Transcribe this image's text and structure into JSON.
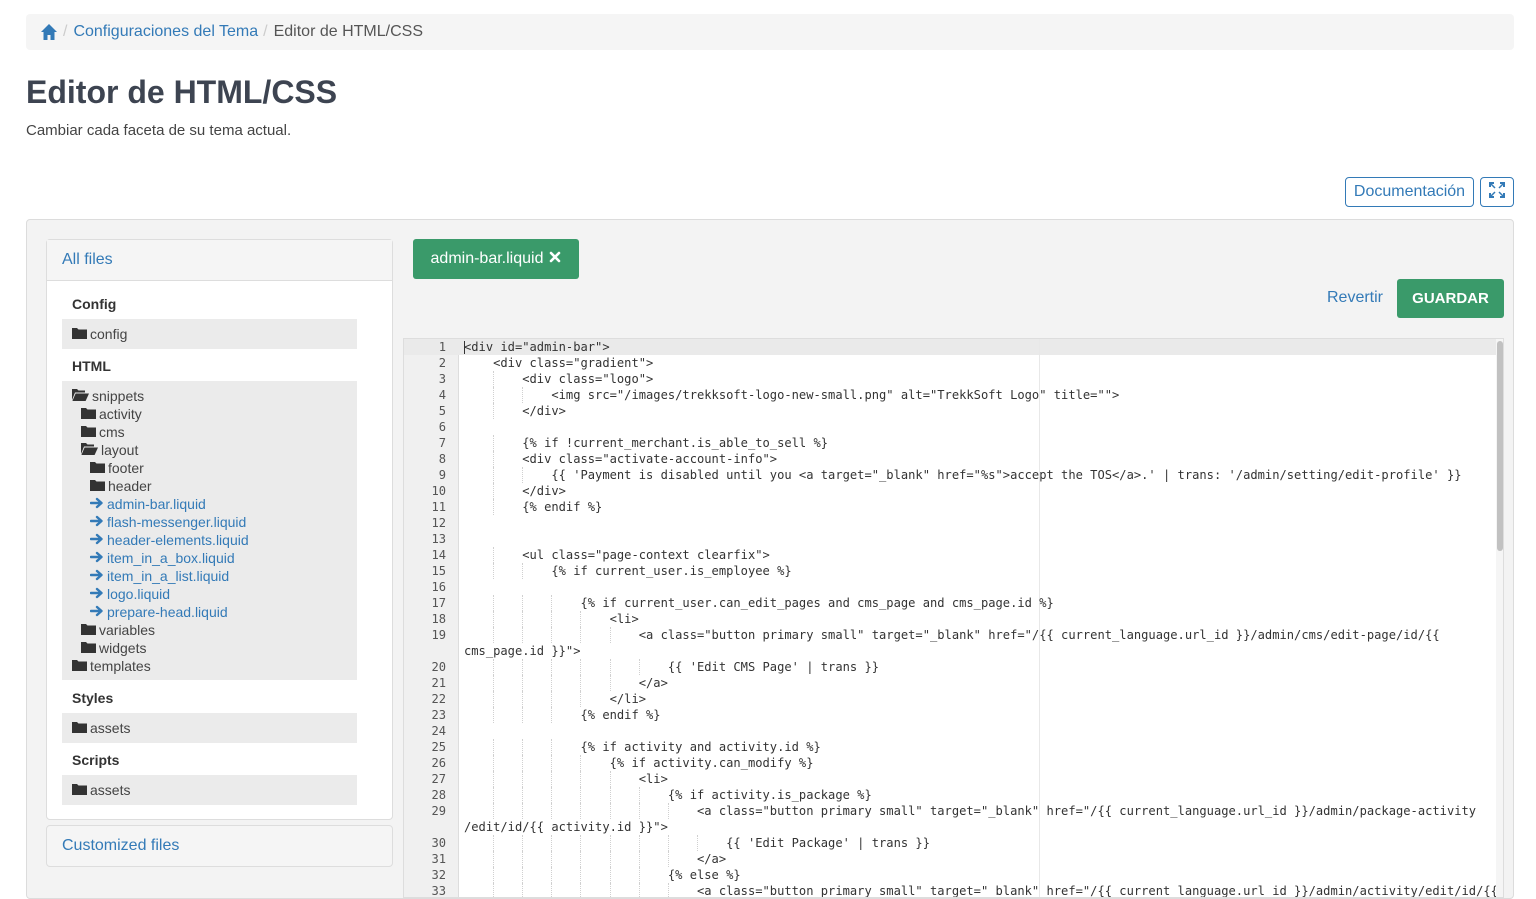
{
  "breadcrumb": {
    "home_icon": "home-icon",
    "items": [
      "Configuraciones del Tema",
      "Editor de HTML/CSS"
    ]
  },
  "page": {
    "title": "Editor de HTML/CSS",
    "subtitle": "Cambiar cada faceta de su tema actual."
  },
  "toolbar": {
    "documentation_label": "Documentación",
    "fullscreen_icon": "expand-icon"
  },
  "sidebar": {
    "all_files_label": "All files",
    "customized_files_label": "Customized files",
    "groups": {
      "config": {
        "title": "Config",
        "items": [
          "config"
        ]
      },
      "html": {
        "title": "HTML",
        "items": [
          "snippets",
          "activity",
          "cms",
          "layout",
          "footer",
          "header",
          "admin-bar.liquid",
          "flash-messenger.liquid",
          "header-elements.liquid",
          "item_in_a_box.liquid",
          "item_in_a_list.liquid",
          "logo.liquid",
          "prepare-head.liquid",
          "variables",
          "widgets",
          "templates"
        ]
      },
      "styles": {
        "title": "Styles",
        "items": [
          "assets"
        ]
      },
      "scripts": {
        "title": "Scripts",
        "items": [
          "assets"
        ]
      }
    }
  },
  "editor": {
    "open_tab": "admin-bar.liquid",
    "close_icon": "close-icon",
    "revert_label": "Revertir",
    "save_label": "GUARDAR",
    "lines": [
      {
        "n": "1",
        "t": "<div id=\"admin-bar\">"
      },
      {
        "n": "2",
        "t": "    <div class=\"gradient\">"
      },
      {
        "n": "3",
        "t": "        <div class=\"logo\">"
      },
      {
        "n": "4",
        "t": "            <img src=\"/images/trekksoft-logo-new-small.png\" alt=\"TrekkSoft Logo\" title=\"\">"
      },
      {
        "n": "5",
        "t": "        </div>"
      },
      {
        "n": "6",
        "t": ""
      },
      {
        "n": "7",
        "t": "        {% if !current_merchant.is_able_to_sell %}"
      },
      {
        "n": "8",
        "t": "        <div class=\"activate-account-info\">"
      },
      {
        "n": "9",
        "t": "            {{ 'Payment is disabled until you <a target=\"_blank\" href=\"%s\">accept the TOS</a>.' | trans: '/admin/setting/edit-profile' }}"
      },
      {
        "n": "10",
        "t": "        </div>"
      },
      {
        "n": "11",
        "t": "        {% endif %}"
      },
      {
        "n": "12",
        "t": ""
      },
      {
        "n": "13",
        "t": ""
      },
      {
        "n": "14",
        "t": "        <ul class=\"page-context clearfix\">"
      },
      {
        "n": "15",
        "t": "            {% if current_user.is_employee %}"
      },
      {
        "n": "16",
        "t": ""
      },
      {
        "n": "17",
        "t": "                {% if current_user.can_edit_pages and cms_page and cms_page.id %}"
      },
      {
        "n": "18",
        "t": "                    <li>"
      },
      {
        "n": "19",
        "t": "                        <a class=\"button primary small\" target=\"_blank\" href=\"/{{ current_language.url_id }}/admin/cms/edit-page/id/{{"
      },
      {
        "n": "",
        "t": "cms_page.id }}\">"
      },
      {
        "n": "20",
        "t": "                            {{ 'Edit CMS Page' | trans }}"
      },
      {
        "n": "21",
        "t": "                        </a>"
      },
      {
        "n": "22",
        "t": "                    </li>"
      },
      {
        "n": "23",
        "t": "                {% endif %}"
      },
      {
        "n": "24",
        "t": ""
      },
      {
        "n": "25",
        "t": "                {% if activity and activity.id %}"
      },
      {
        "n": "26",
        "t": "                    {% if activity.can_modify %}"
      },
      {
        "n": "27",
        "t": "                        <li>"
      },
      {
        "n": "28",
        "t": "                            {% if activity.is_package %}"
      },
      {
        "n": "29",
        "t": "                                <a class=\"button primary small\" target=\"_blank\" href=\"/{{ current_language.url_id }}/admin/package-activity"
      },
      {
        "n": "",
        "t": "/edit/id/{{ activity.id }}\">"
      },
      {
        "n": "30",
        "t": "                                    {{ 'Edit Package' | trans }}"
      },
      {
        "n": "31",
        "t": "                                </a>"
      },
      {
        "n": "32",
        "t": "                            {% else %}"
      },
      {
        "n": "33",
        "t": "                                <a class=\"button primary small\" target=\"_blank\" href=\"/{{ current_language.url_id }}/admin/activity/edit/id/{{"
      }
    ]
  }
}
